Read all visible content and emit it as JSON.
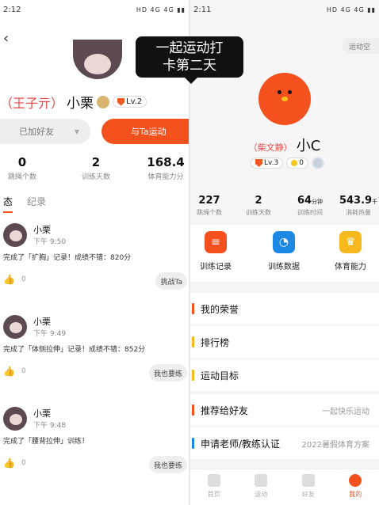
{
  "left": {
    "status": {
      "time": "2:12",
      "icons": "HD 4G 4G ▮▮"
    },
    "back_icon": "chevron-left-icon",
    "profile": {
      "note": "（王子亓）",
      "name": "小栗",
      "level": "Lv.2"
    },
    "buttons": {
      "added": "已加好友",
      "sport_with": "与Ta运动"
    },
    "stats": [
      {
        "value": "0",
        "label": "跳绳个数"
      },
      {
        "value": "2",
        "label": "训练天数"
      },
      {
        "value": "168.4",
        "label": "体育能力分"
      }
    ],
    "tabs": [
      "态",
      "纪录"
    ],
    "feed": [
      {
        "name": "小栗",
        "time": "下午 9:50",
        "text": "完成了「扩胸」记录！成绩不错：820分",
        "likes": "0",
        "action": "挑战Ta"
      },
      {
        "name": "小栗",
        "time": "下午 9:49",
        "text": "完成了「体侧拉伸」记录！成绩不错：852分",
        "likes": "0",
        "action": "我也要练"
      },
      {
        "name": "小栗",
        "time": "下午 9:48",
        "text": "完成了「腰背拉伸」训练！",
        "likes": "0",
        "action": "我也要练"
      }
    ]
  },
  "bubble": {
    "line1": "一起运动打",
    "line2": "卡第二天"
  },
  "right": {
    "status": {
      "time": "2:11",
      "icons": "HD 4G 4G ▮▮"
    },
    "sport_space": "运动空",
    "profile": {
      "note": "（柴文静）",
      "name": "小C",
      "level": "Lv.3",
      "coins": "0"
    },
    "stats": [
      {
        "value": "227",
        "unit": "",
        "label": "跳绳个数"
      },
      {
        "value": "2",
        "unit": "",
        "label": "训练天数"
      },
      {
        "value": "64",
        "unit": "分钟",
        "label": "训练时间"
      },
      {
        "value": "543.9",
        "unit": "千",
        "label": "消耗热量"
      }
    ],
    "functions": [
      {
        "label": "训练记录",
        "color": "#f4511e"
      },
      {
        "label": "训练数据",
        "color": "#1e88e5"
      },
      {
        "label": "体育能力",
        "color": "#f6b91d"
      }
    ],
    "menu": [
      {
        "label": "我的荣誉",
        "sub": "",
        "color": "#f4511e"
      },
      {
        "label": "排行榜",
        "sub": "",
        "color": "#f6b91d"
      },
      {
        "label": "运动目标",
        "sub": "",
        "color": "#f6b91d"
      },
      {
        "label": "推荐给好友",
        "sub": "一起快乐运动",
        "color": "#f4511e"
      },
      {
        "label": "申请老师/教练认证",
        "sub": "2022暑假体育方案",
        "color": "#1e88e5"
      }
    ],
    "nav": [
      "首页",
      "运动",
      "好友",
      "我的"
    ]
  }
}
